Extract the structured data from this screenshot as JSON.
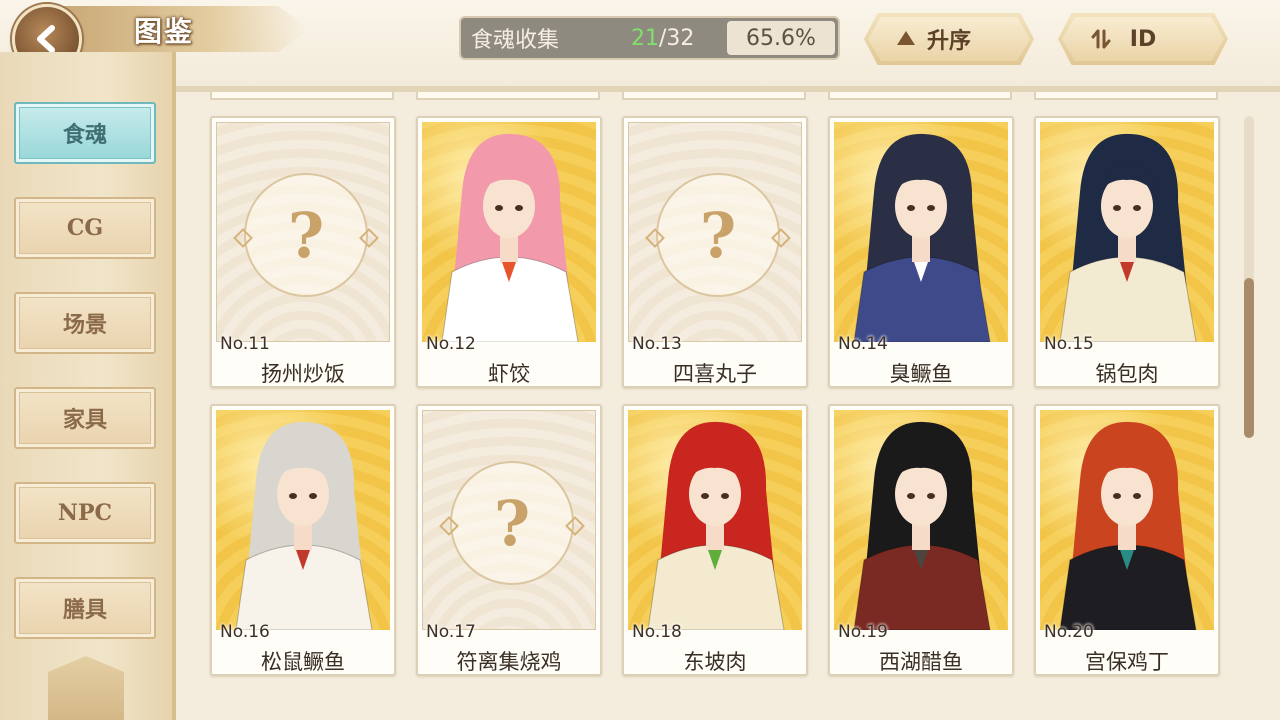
{
  "header": {
    "title": "图鉴",
    "collection_label": "食魂收集",
    "collected": "21",
    "total": "/32",
    "percent": "65.6%",
    "sort_order_label": "升序",
    "sort_key_label": "ID"
  },
  "sidebar": {
    "items": [
      {
        "label": "食魂",
        "active": true
      },
      {
        "label": "CG"
      },
      {
        "label": "场景"
      },
      {
        "label": "家具"
      },
      {
        "label": "NPC"
      },
      {
        "label": "膳具"
      }
    ]
  },
  "cards": [
    {
      "no": "No.11",
      "name": "扬州炒饭",
      "locked": true
    },
    {
      "no": "No.12",
      "name": "虾饺",
      "locked": false,
      "hair": "#f29aab",
      "outfit": "#ffffff",
      "accent": "#e8542c"
    },
    {
      "no": "No.13",
      "name": "四喜丸子",
      "locked": true
    },
    {
      "no": "No.14",
      "name": "臭鳜鱼",
      "locked": false,
      "hair": "#2b2f45",
      "outfit": "#3f4a8a",
      "accent": "#ffffff"
    },
    {
      "no": "No.15",
      "name": "锅包肉",
      "locked": false,
      "hair": "#1f2a44",
      "outfit": "#f3ead2",
      "accent": "#c0392b"
    },
    {
      "no": "No.16",
      "name": "松鼠鳜鱼",
      "locked": false,
      "hair": "#d8d6cf",
      "outfit": "#f7f3ea",
      "accent": "#c0392b"
    },
    {
      "no": "No.17",
      "name": "符离集烧鸡",
      "locked": true
    },
    {
      "no": "No.18",
      "name": "东坡肉",
      "locked": false,
      "hair": "#c8261e",
      "outfit": "#f4ead0",
      "accent": "#5fae3a"
    },
    {
      "no": "No.19",
      "name": "西湖醋鱼",
      "locked": false,
      "hair": "#1a1a1a",
      "outfit": "#7a2a22",
      "accent": "#4b4540"
    },
    {
      "no": "No.20",
      "name": "宫保鸡丁",
      "locked": false,
      "hair": "#c9441f",
      "outfit": "#1e1e22",
      "accent": "#2a8b86"
    }
  ],
  "colors": {
    "collected_count": "#7fe06a",
    "active_tab": "#97d6d8",
    "card_gold": "#f2c549"
  }
}
